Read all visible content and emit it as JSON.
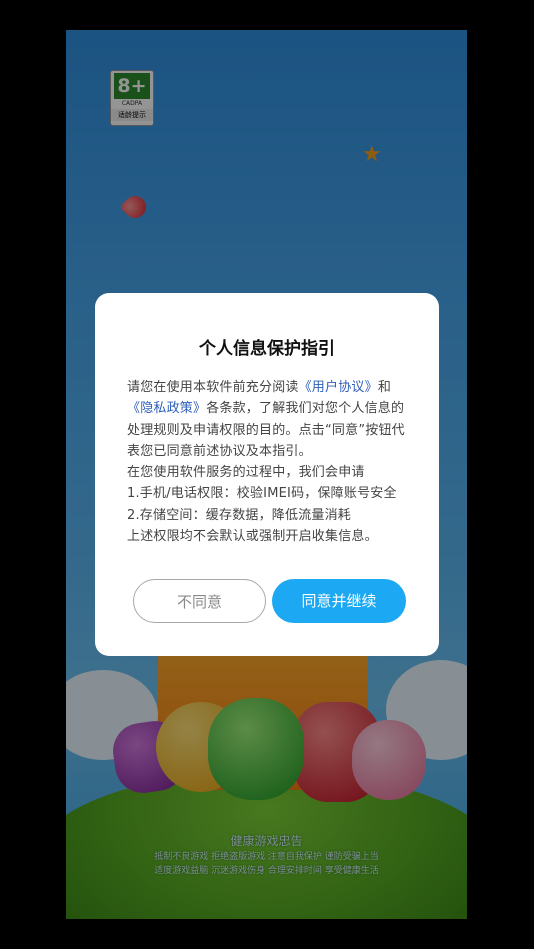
{
  "age_rating": {
    "number": "8+",
    "org": "CADPA",
    "note": "适龄提示"
  },
  "health_notice": {
    "title": "健康游戏忠告",
    "lines": [
      "抵制不良游戏  拒绝盗版游戏  注意自我保护  谨防受骗上当",
      "适度游戏益脑  沉迷游戏伤身  合理安排时间  享受健康生活"
    ]
  },
  "dialog": {
    "title": "个人信息保护指引",
    "para1_prefix": "请您在使用本软件前充分阅读",
    "user_agreement_link": "《用户协议》",
    "para1_and": "和",
    "privacy_policy_link": "《隐私政策》",
    "para1_suffix": "各条款，了解我们对您个人信息的处理规则及申请权限的目的。点击“同意”按钮代表您已同意前述协议及本指引。",
    "line_intro": "在您使用软件服务的过程中，我们会申请",
    "line_perm1": "1.手机/电话权限：校验IMEI码，保障账号安全",
    "line_perm2": "2.存储空间：缓存数据，降低流量消耗",
    "line_note": "上述权限均不会默认或强制开启收集信息。",
    "decline_label": "不同意",
    "accept_label": "同意并继续"
  },
  "colors": {
    "accent": "#1ca8f2",
    "link": "#2f5fb9",
    "age_badge": "#2d8c2d"
  }
}
